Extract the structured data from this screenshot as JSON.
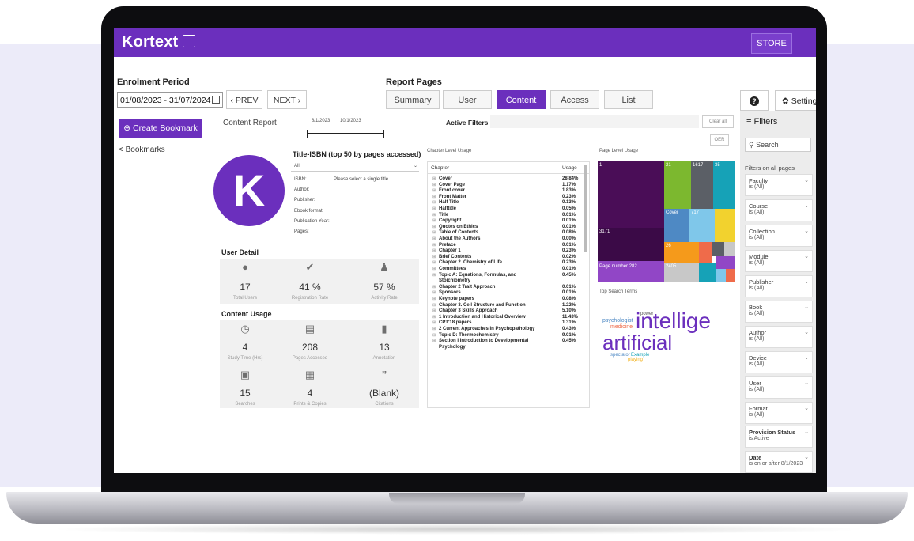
{
  "app": {
    "logo": "Kortext",
    "store_label": "STORE"
  },
  "toolbar": {
    "enrolment_label": "Enrolment Period",
    "date_range": "01/08/2023 - 31/07/2024",
    "prev_label": "‹ PREV",
    "next_label": "NEXT ›",
    "report_pages_label": "Report Pages",
    "tabs": [
      "Summary",
      "User",
      "Content",
      "Access",
      "List"
    ],
    "active_tab": "Content",
    "help_label": "?",
    "settings_label": "Settings"
  },
  "sidebar": {
    "create_label": "Create Bookmark",
    "bookmarks_label": "< Bookmarks"
  },
  "content": {
    "report_title": "Content Report",
    "date_slider": {
      "start": "8/1/2023",
      "end": "10/1/2023"
    },
    "active_filters_label": "Active Filters",
    "clear_all_label": "Clear all",
    "oer_label": "OER",
    "title_isbn_heading": "Title-ISBN (top 50 by pages accessed)",
    "title_select_value": "All",
    "avatar_letter": "K",
    "meta": [
      {
        "label": "ISBN:",
        "value": "Please select a single title"
      },
      {
        "label": "Author:",
        "value": ""
      },
      {
        "label": "Publisher:",
        "value": ""
      },
      {
        "label": "Ebook format:",
        "value": ""
      },
      {
        "label": "Publication Year:",
        "value": ""
      },
      {
        "label": "Pages:",
        "value": ""
      }
    ],
    "user_detail_title": "User Detail",
    "user_detail": [
      {
        "icon": "person-icon",
        "value": "17",
        "label": "Total Users"
      },
      {
        "icon": "person-check-icon",
        "value": "41 %",
        "label": "Registration Rate"
      },
      {
        "icon": "person-activity-icon",
        "value": "57 %",
        "label": "Activity Rate"
      }
    ],
    "content_usage_title": "Content Usage",
    "content_usage": [
      {
        "icon": "clock-icon",
        "value": "4",
        "label": "Study Time (Hrs)"
      },
      {
        "icon": "book-open-icon",
        "value": "208",
        "label": "Pages Accessed"
      },
      {
        "icon": "document-icon",
        "value": "13",
        "label": "Annotation"
      },
      {
        "icon": "search-document-icon",
        "value": "15",
        "label": "Searches"
      },
      {
        "icon": "printer-icon",
        "value": "4",
        "label": "Prints & Copies"
      },
      {
        "icon": "quote-icon",
        "value": "(Blank)",
        "label": "Citations"
      }
    ]
  },
  "chapter_table": {
    "title": "Chapter Level Usage",
    "col_chapter": "Chapter",
    "col_usage": "Usage",
    "rows": [
      [
        "Cover",
        "28.84%"
      ],
      [
        "Cover Page",
        "1.17%"
      ],
      [
        "Front cover",
        "1.83%"
      ],
      [
        "Front Matter",
        "0.23%"
      ],
      [
        "Half Title",
        "0.13%"
      ],
      [
        "Halftitle",
        "0.05%"
      ],
      [
        "Title",
        "0.01%"
      ],
      [
        "Copyright",
        "0.01%"
      ],
      [
        "Quotes on Ethics",
        "0.01%"
      ],
      [
        "Table of Contents",
        "0.08%"
      ],
      [
        "About the Authors",
        "0.00%"
      ],
      [
        "Preface",
        "0.01%"
      ],
      [
        "Chapter 1",
        "0.23%"
      ],
      [
        "Brief Contents",
        "0.02%"
      ],
      [
        "Chapter 2. Chemistry of Life",
        "0.23%"
      ],
      [
        "Committees",
        "0.01%"
      ],
      [
        "Topic A: Equations, Formulas, and",
        "0.45%"
      ],
      [
        "Stoichiometry",
        ""
      ],
      [
        "Chapter 2 Trait Approach",
        "0.01%"
      ],
      [
        "Sponsors",
        "0.01%"
      ],
      [
        "Keynote papers",
        "0.08%"
      ],
      [
        "Chapter 3. Cell Structure and Function",
        "1.22%"
      ],
      [
        "Chapter 3 Skills Approach",
        "5.10%"
      ],
      [
        "1 Introduction and Historical Overview",
        "11.43%"
      ],
      [
        "CPT'18 papers",
        "1.31%"
      ],
      [
        "2 Current Approaches in Psychopathology",
        "0.43%"
      ],
      [
        "Topic D: Thermochemistry",
        "9.01%"
      ],
      [
        "Section I Introduction to Developmental",
        "0.45%"
      ],
      [
        "Psychology",
        ""
      ]
    ]
  },
  "page_usage": {
    "title": "Page Level Usage",
    "labels": [
      "1",
      "21",
      "1617",
      "35",
      "Cover",
      "717",
      "3171",
      "26",
      "Page number 282",
      "2405"
    ]
  },
  "search_terms": {
    "title": "Top Search Terms",
    "words": [
      "psychologist",
      "power",
      "medicine",
      "intellige",
      "artificial",
      "spectator",
      "Example",
      "playing"
    ]
  },
  "filters": {
    "title": "Filters",
    "search_placeholder": "Search",
    "on_all_pages": "Filters on all pages",
    "items": [
      {
        "name": "Faculty",
        "value": "is (All)"
      },
      {
        "name": "Course",
        "value": "is (All)"
      },
      {
        "name": "Collection",
        "value": "is (All)"
      },
      {
        "name": "Module",
        "value": "is (All)"
      },
      {
        "name": "Publisher",
        "value": "is (All)"
      },
      {
        "name": "Book",
        "value": "is (All)"
      },
      {
        "name": "Author",
        "value": "is (All)"
      },
      {
        "name": "Device",
        "value": "is (All)"
      },
      {
        "name": "User",
        "value": "is (All)"
      },
      {
        "name": "Format",
        "value": "is (All)"
      },
      {
        "name": "Provision Status",
        "value": "is Active"
      },
      {
        "name": "Date",
        "value": "is on or after 8/1/2023"
      }
    ]
  },
  "colors": {
    "brand": "#6b2fbd",
    "treemap": [
      "#4a0d57",
      "#7cb82f",
      "#5b5f66",
      "#16a2b7",
      "#4e89c4",
      "#7fc7ea",
      "#f2d22e",
      "#f59a1b",
      "#9146c6",
      "#c8c8c8",
      "#ef6b4a"
    ]
  }
}
